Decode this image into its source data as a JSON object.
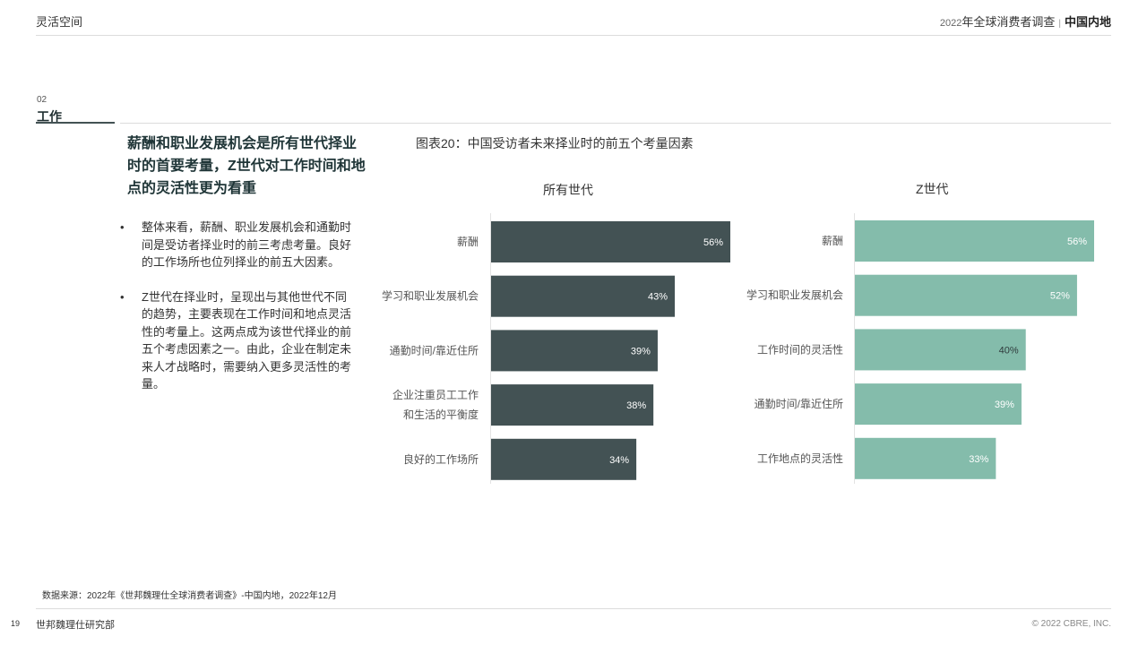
{
  "header": {
    "left": "灵活空间",
    "year": "2022",
    "survey": "年全球消费者调查",
    "separator": "|",
    "region": "中国内地"
  },
  "section": {
    "number": "02",
    "name": "工作"
  },
  "headline": "薪酬和职业发展机会是所有世代择业时的首要考量，Z世代对工作时间和地点的灵活性更为看重",
  "bullets": [
    "整体来看，薪酬、职业发展机会和通勤时间是受访者择业时的前三考虑考量。良好的工作场所也位列择业的前五大因素。",
    "Z世代在择业时，呈现出与其他世代不同的趋势，主要表现在工作时间和地点灵活性的考量上。这两点成为该世代择业的前五个考虑因素之一。由此，企业在制定未来人才战略时，需要纳入更多灵活性的考量。"
  ],
  "bullet_symbol": "•",
  "figure_title": "图表20：中国受访者未来择业时的前五个考量因素",
  "colors": {
    "all_generations": "#435254",
    "gen_z": "#84bcab",
    "label_light": "#ffffff",
    "label_dark": "#2f3b3c"
  },
  "chart_data": [
    {
      "type": "bar",
      "orientation": "horizontal",
      "title": "所有世代",
      "categories": [
        [
          "薪酬"
        ],
        [
          "学习和职业发展机会"
        ],
        [
          "通勤时间/靠近住所"
        ],
        [
          "企业注重员工工作",
          "和生活的平衡度"
        ],
        [
          "良好的工作场所"
        ]
      ],
      "values": [
        56,
        43,
        39,
        38,
        34
      ],
      "value_labels": [
        "56%",
        "43%",
        "39%",
        "38%",
        "34%"
      ],
      "xlim": [
        0,
        56
      ],
      "color": "#435254"
    },
    {
      "type": "bar",
      "orientation": "horizontal",
      "title": "Z世代",
      "categories": [
        [
          "薪酬"
        ],
        [
          "学习和职业发展机会"
        ],
        [
          "工作时间的灵活性"
        ],
        [
          "通勤时间/靠近住所"
        ],
        [
          "工作地点的灵活性"
        ]
      ],
      "values": [
        56,
        52,
        40,
        39,
        33
      ],
      "value_labels": [
        "56%",
        "52%",
        "40%",
        "39%",
        "33%"
      ],
      "xlim": [
        0,
        56
      ],
      "color": "#84bcab"
    }
  ],
  "footer": {
    "source": "数据来源：2022年《世邦魏理仕全球消费者调查》-中国内地，2022年12月",
    "page_number": "19",
    "org": "世邦魏理仕研究部",
    "copyright": "© 2022 CBRE, INC."
  }
}
